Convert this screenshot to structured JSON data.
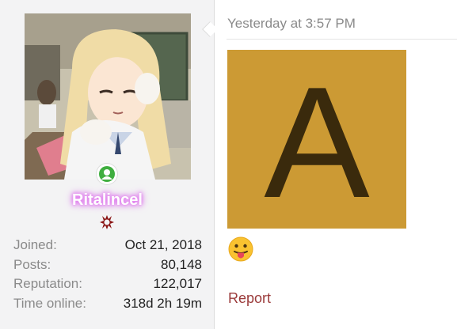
{
  "user": {
    "name": "Ritalincel",
    "avatar_icon": "anime-girl-avatar",
    "online_status_icon": "online-user-icon",
    "rank_icon": "angry-emblem-icon",
    "name_glow_color": "#e47bf0"
  },
  "stats": [
    {
      "label": "Joined:",
      "value": "Oct 21, 2018"
    },
    {
      "label": "Posts:",
      "value": "80,148"
    },
    {
      "label": "Reputation:",
      "value": "122,017"
    },
    {
      "label": "Time online:",
      "value": "318d 2h 19m"
    }
  ],
  "post": {
    "timestamp": "Yesterday at 3:57 PM",
    "image_letter": "A",
    "image_bg_color": "#cc9a34",
    "emoji_icon": "tongue-out-emoji",
    "report_label": "Report"
  }
}
